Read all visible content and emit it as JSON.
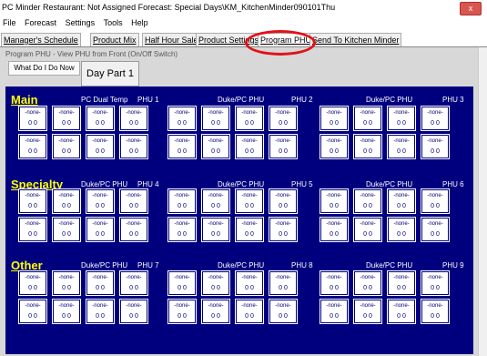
{
  "window": {
    "title": "PC Minder   Restaurant: Not Assigned   Forecast: Special Days\\KM_KitchenMinder090101Thu",
    "close": "x"
  },
  "menu": [
    "File",
    "Forecast",
    "Settings",
    "Tools",
    "Help"
  ],
  "tabs": [
    "Manager's Schedule",
    "Product Mix",
    "Half Hour Sales",
    "Product Settings",
    "Program PHU",
    "Send To Kitchen Minder"
  ],
  "page": {
    "subtitle": "Program PHU - View PHU from Front (On/Off Switch)",
    "what_btn": "What Do I Do Now",
    "day_part": "Day Part 1"
  },
  "sections": [
    {
      "label": "Main",
      "phus": [
        {
          "type": "PC Dual Temp",
          "id": "PHU 1"
        },
        {
          "type": "Duke/PC PHU",
          "id": "PHU 2"
        },
        {
          "type": "Duke/PC PHU",
          "id": "PHU 3"
        }
      ]
    },
    {
      "label": "Specialty",
      "phus": [
        {
          "type": "Duke/PC PHU",
          "id": "PHU 4"
        },
        {
          "type": "Duke/PC PHU",
          "id": "PHU 5"
        },
        {
          "type": "Duke/PC PHU",
          "id": "PHU 6"
        }
      ]
    },
    {
      "label": "Other",
      "phus": [
        {
          "type": "Duke/PC PHU",
          "id": "PHU 7"
        },
        {
          "type": "Duke/PC PHU",
          "id": "PHU 8"
        },
        {
          "type": "Duke/PC PHU",
          "id": "PHU 9"
        }
      ]
    }
  ],
  "cell": {
    "product": "-none-",
    "count": "0  0"
  },
  "colors": {
    "panel": "#00007f",
    "section_label": "#ffff00",
    "highlight": "#e3101a"
  }
}
